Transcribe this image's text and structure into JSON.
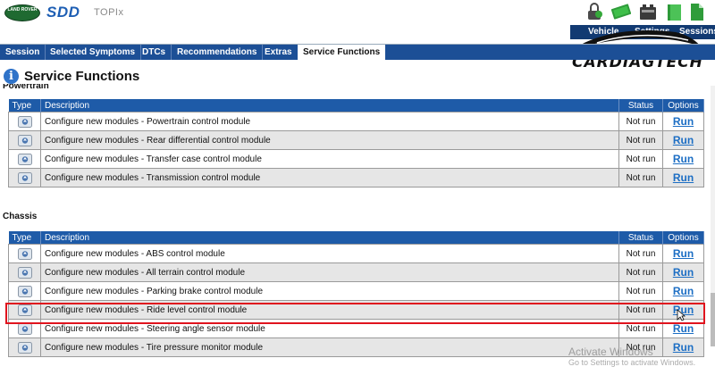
{
  "header": {
    "brand_badge": "LAND ROVER",
    "app_name": "SDD",
    "subtitle": "TOPIx",
    "icons": [
      "padlock-icon",
      "money-icon",
      "battery-icon",
      "book-icon",
      "document-icon"
    ],
    "right_tabs": [
      "Vehicle",
      "Settings",
      "Sessions"
    ],
    "watermark": "CARDIAGTECH"
  },
  "nav": {
    "tabs": [
      "Session",
      "Selected Symptoms",
      "DTCs",
      "Recommendations",
      "Extras",
      "Service Functions"
    ],
    "active": "Service Functions"
  },
  "page": {
    "title": "Service Functions",
    "sections": [
      {
        "label": "Powertrain",
        "columns": [
          "Type",
          "Description",
          "Status",
          "Options"
        ],
        "rows": [
          {
            "description": "Configure new modules - Powertrain control module",
            "status": "Not run",
            "option": "Run"
          },
          {
            "description": "Configure new modules - Rear differential control module",
            "status": "Not run",
            "option": "Run"
          },
          {
            "description": "Configure new modules - Transfer case control module",
            "status": "Not run",
            "option": "Run"
          },
          {
            "description": "Configure new modules - Transmission control module",
            "status": "Not run",
            "option": "Run"
          }
        ]
      },
      {
        "label": "Chassis",
        "columns": [
          "Type",
          "Description",
          "Status",
          "Options"
        ],
        "rows": [
          {
            "description": "Configure new modules - ABS control module",
            "status": "Not run",
            "option": "Run"
          },
          {
            "description": "Configure new modules - All terrain control module",
            "status": "Not run",
            "option": "Run"
          },
          {
            "description": "Configure new modules - Parking brake control module",
            "status": "Not run",
            "option": "Run"
          },
          {
            "description": "Configure new modules - Ride level control module",
            "status": "Not run",
            "option": "Run",
            "highlighted": true
          },
          {
            "description": "Configure new modules - Steering angle sensor module",
            "status": "Not run",
            "option": "Run"
          },
          {
            "description": "Configure new modules - Tire pressure monitor module",
            "status": "Not run",
            "option": "Run"
          }
        ]
      }
    ]
  },
  "os_overlay": {
    "line1": "Activate Windows",
    "line2": "Go to Settings to activate Windows."
  },
  "colors": {
    "nav_bg": "#1c4f96",
    "table_header": "#1e5ba8",
    "run_link": "#1c6ec4",
    "highlight": "#e0141e"
  }
}
